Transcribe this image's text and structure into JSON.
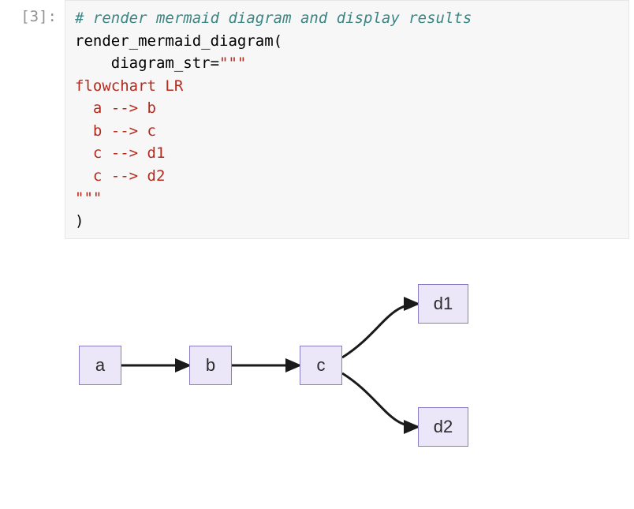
{
  "cell": {
    "prompt": "[3]:",
    "code": {
      "comment": "# render mermaid diagram and display results",
      "func_call": "render_mermaid_diagram(",
      "arg_indent": "    diagram_str",
      "equals": "=",
      "open_quotes": "\"\"\"",
      "body_lines": [
        "flowchart LR",
        "  a --> b",
        "  b --> c",
        "  c --> d1",
        "  c --> d2"
      ],
      "close_quotes": "\"\"\"",
      "close_paren": ")"
    }
  },
  "diagram": {
    "type": "flowchart-lr",
    "nodes": [
      {
        "id": "a",
        "label": "a"
      },
      {
        "id": "b",
        "label": "b"
      },
      {
        "id": "c",
        "label": "c"
      },
      {
        "id": "d1",
        "label": "d1"
      },
      {
        "id": "d2",
        "label": "d2"
      }
    ],
    "edges": [
      {
        "from": "a",
        "to": "b"
      },
      {
        "from": "b",
        "to": "c"
      },
      {
        "from": "c",
        "to": "d1"
      },
      {
        "from": "c",
        "to": "d2"
      }
    ]
  },
  "chart_data": {
    "type": "flowchart",
    "direction": "LR",
    "nodes": [
      "a",
      "b",
      "c",
      "d1",
      "d2"
    ],
    "edges": [
      [
        "a",
        "b"
      ],
      [
        "b",
        "c"
      ],
      [
        "c",
        "d1"
      ],
      [
        "c",
        "d2"
      ]
    ]
  }
}
